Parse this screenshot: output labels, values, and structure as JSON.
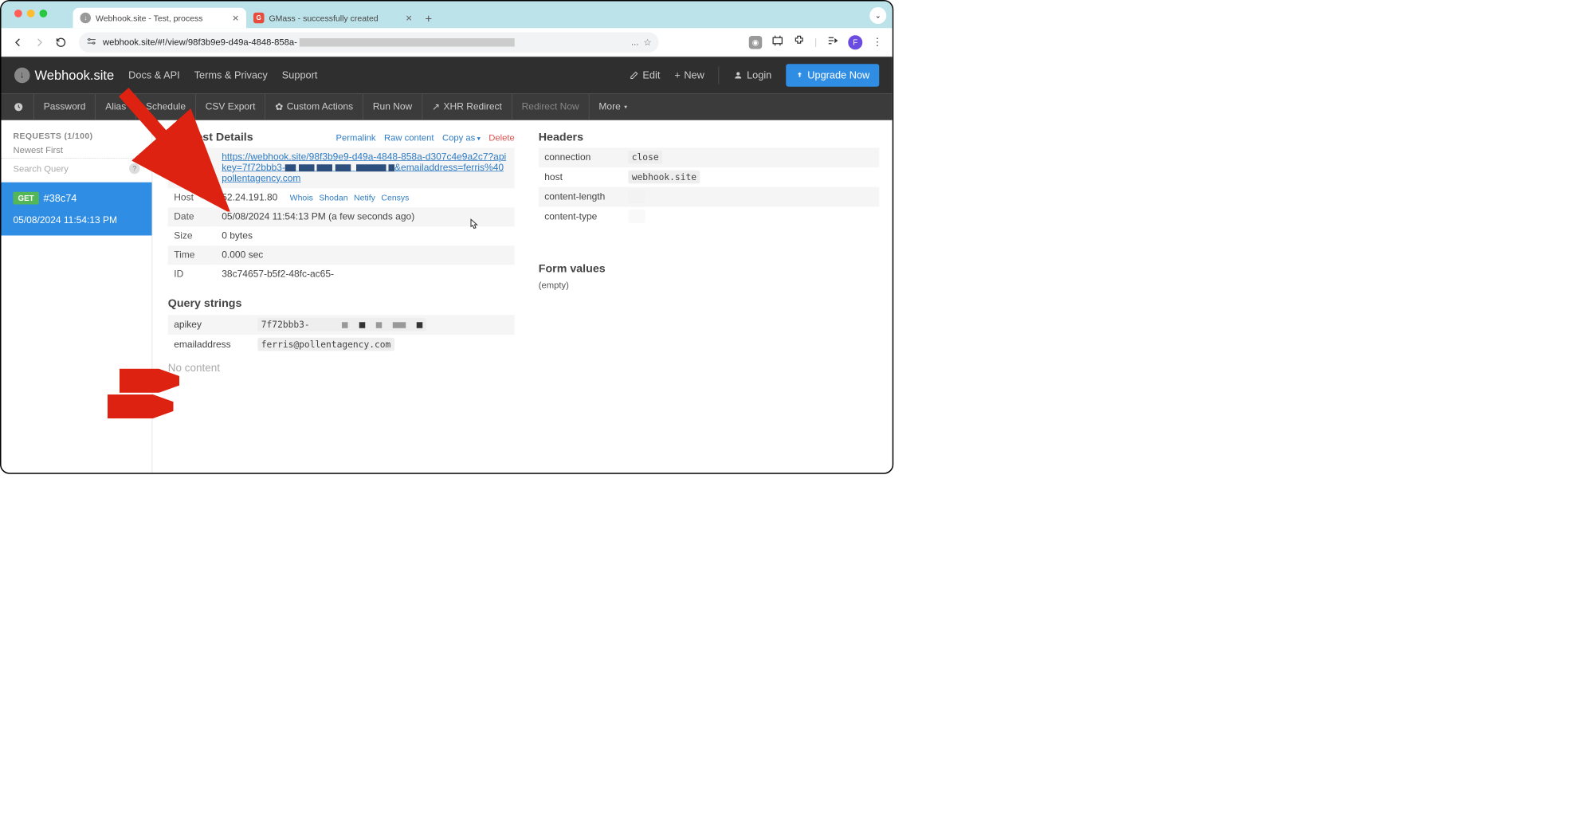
{
  "browser": {
    "tabs": [
      {
        "title": "Webhook.site - Test, process",
        "favicon": "gray"
      },
      {
        "title": "GMass - successfully created",
        "favicon": "red"
      }
    ],
    "url_display": "webhook.site/#!/view/98f3b9e9-d49a-4848-858a-",
    "avatar_letter": "F"
  },
  "app_header": {
    "brand": "Webhook.site",
    "links": [
      "Docs & API",
      "Terms & Privacy",
      "Support"
    ],
    "edit": "Edit",
    "new": "New",
    "login": "Login",
    "upgrade": "Upgrade Now"
  },
  "sub_nav": {
    "items": [
      "Password",
      "Alias",
      "Schedule",
      "CSV Export",
      "Custom Actions",
      "Run Now",
      "XHR Redirect",
      "Redirect Now",
      "More"
    ]
  },
  "sidebar": {
    "requests_label": "REQUESTS (1/100)",
    "newest_first": "Newest First",
    "search_placeholder": "Search Query",
    "selected": {
      "method": "GET",
      "short_id": "#38c74",
      "date": "05/08/2024 11:54:13 PM"
    }
  },
  "details": {
    "title": "Request Details",
    "links": {
      "permalink": "Permalink",
      "raw": "Raw content",
      "copy": "Copy as",
      "delete": "Delete"
    },
    "method": "GET",
    "url_prefix": "https://webhook.site/98f3b9e9-d49a-4848-858a-d307c4e9a2c7?apikey=7f72bbb3-",
    "url_suffix": "&emailaddress=ferris%40pollentagency.com",
    "rows": {
      "host_label": "Host",
      "host_value": "52.24.191.80",
      "host_links": [
        "Whois",
        "Shodan",
        "Netify",
        "Censys"
      ],
      "date_label": "Date",
      "date_value": "05/08/2024 11:54:13 PM (a few seconds ago)",
      "size_label": "Size",
      "size_value": "0 bytes",
      "time_label": "Time",
      "time_value": "0.000 sec",
      "id_label": "ID",
      "id_value": "38c74657-b5f2-48fc-ac65-"
    }
  },
  "headers": {
    "title": "Headers",
    "rows": [
      {
        "k": "connection",
        "v": "close"
      },
      {
        "k": "host",
        "v": "webhook.site"
      },
      {
        "k": "content-length",
        "v": ""
      },
      {
        "k": "content-type",
        "v": ""
      }
    ]
  },
  "query": {
    "title": "Query strings",
    "rows": [
      {
        "k": "apikey",
        "v": "7f72bbb3-"
      },
      {
        "k": "emailaddress",
        "v": "ferris@pollentagency.com"
      }
    ],
    "no_content": "No content"
  },
  "form_values": {
    "title": "Form values",
    "empty": "(empty)"
  }
}
